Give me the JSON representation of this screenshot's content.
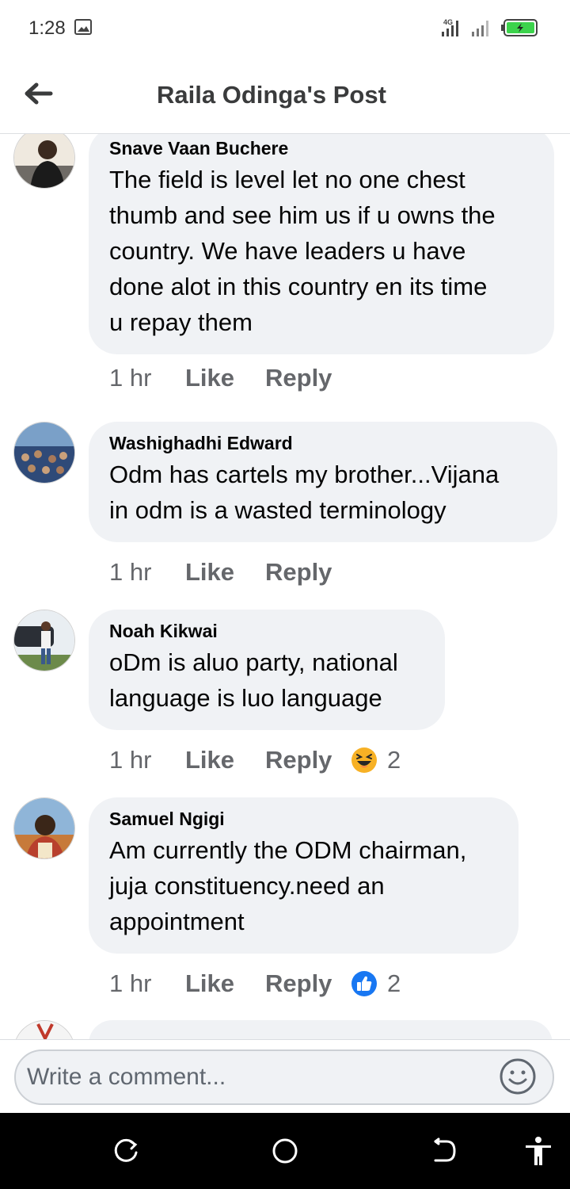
{
  "status_bar": {
    "time": "1:28",
    "network": "4G",
    "battery_color": "#3cd34c"
  },
  "header": {
    "title": "Raila Odinga's Post"
  },
  "comments": [
    {
      "author": "Snave Vaan Buchere",
      "lines": [
        "The field is level let no one chest",
        "thumb and see him us if u owns the",
        "country. We have leaders u have",
        "done alot in this country en its time",
        "u repay them"
      ],
      "time": "1 hr",
      "like": "Like",
      "reply": "Reply"
    },
    {
      "author": "Washighadhi Edward",
      "lines": [
        "Odm has cartels my brother...Vijana",
        "in odm is a wasted terminology"
      ],
      "time": "1 hr",
      "like": "Like",
      "reply": "Reply"
    },
    {
      "author": "Noah Kikwai",
      "lines": [
        "oDm is aluo party, national",
        "language is luo language"
      ],
      "time": "1 hr",
      "like": "Like",
      "reply": "Reply",
      "reaction": {
        "icon": "laughing-emoji-icon",
        "count": "2"
      }
    },
    {
      "author": "Samuel Ngigi",
      "lines": [
        "Am currently the ODM chairman,",
        "juja constituency.need an",
        "appointment"
      ],
      "time": "1 hr",
      "like": "Like",
      "reply": "Reply",
      "reaction": {
        "icon": "thumbs-up-icon",
        "count": "2"
      }
    }
  ],
  "composer": {
    "placeholder": "Write a comment..."
  },
  "colors": {
    "bubble": "#f0f2f5",
    "meta": "#65676b",
    "like_blue": "#1877f2",
    "haha_yellow": "#f7b125"
  }
}
